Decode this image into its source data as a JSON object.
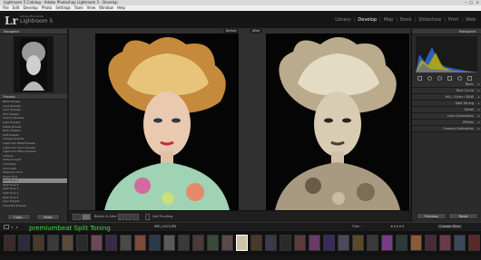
{
  "titlebar": {
    "text": "Lightroom 5 Catalog - Adobe Photoshop Lightroom 5 - Develop"
  },
  "menubar": {
    "items": [
      "File",
      "Edit",
      "Develop",
      "Photo",
      "Settings",
      "Tools",
      "View",
      "Window",
      "Help"
    ]
  },
  "brand": {
    "logo": "Lr",
    "subtitle": "Adobe Photoshop",
    "title": "Lightroom 5"
  },
  "modules": {
    "items": [
      "Library",
      "Develop",
      "Map",
      "Book",
      "Slideshow",
      "Print",
      "Web"
    ],
    "active": "Develop"
  },
  "left_panel": {
    "navigator_label": "Navigator",
    "presets_label": "Presets",
    "preset_items": [
      "B&W Presets",
      "Aqua Presets",
      "Color Presets",
      "Film Presets",
      "Custom Presets",
      "Light Presets",
      "Matte Presets",
      "Retro Presets",
      "Soft Presets",
      "Vintage Presets",
      "Lightroom B&W Presets",
      "Lightroom Color Presets",
      "Lightroom Effect Presets",
      "Antique",
      "Antique Light",
      "Colorfade",
      "Cool Light",
      "Selenium Tone",
      "Sepia Tone",
      "Split Tone 1",
      "Split Tone 2",
      "Split Tone 3",
      "Split Tone 4",
      "Split Tone 5",
      "User Presets",
      "Imported Presets"
    ],
    "selected_index": 19,
    "copy_button": "Copy...",
    "paste_button": "Paste"
  },
  "center": {
    "before_label": "Before",
    "after_label": "After",
    "before_after_label": "Before & After :",
    "soft_proofing_label": "Soft Proofing"
  },
  "right_panel": {
    "histogram_label": "Histogram",
    "sections": [
      "Basic",
      "Tone Curve",
      "HSL / Color / B&W",
      "Split Toning",
      "Detail",
      "Lens Corrections",
      "Effects",
      "Camera Calibration"
    ],
    "previous_button": "Previous",
    "reset_button": "Reset"
  },
  "filmstrip": {
    "file_info": "IMG_0413.JPG",
    "filter_label": "Filter :",
    "filter_value": "Custom Filter",
    "overlay_text": "premiumbeat Split Toning"
  },
  "colors": {
    "accent": "#e8e8e8",
    "overlay_green": "#3ddc3d",
    "histogram_blue": "#2e6bd6",
    "histogram_yellow": "#c8b400"
  }
}
